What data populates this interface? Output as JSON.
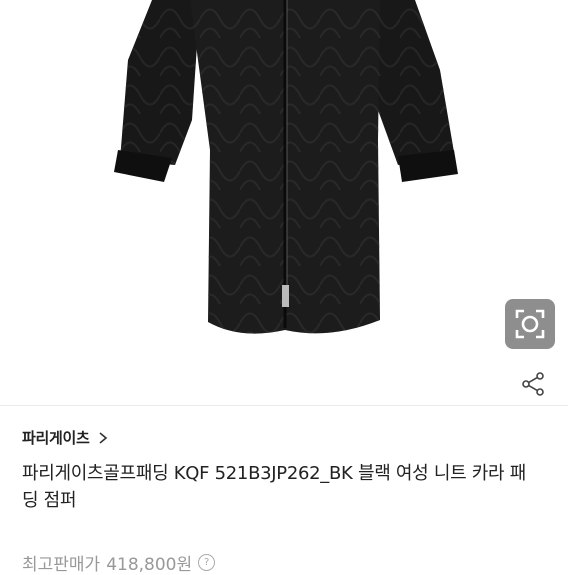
{
  "product": {
    "brand": "파리게이츠",
    "title": "파리게이츠골프패딩 KQF 521B3JP262_BK 블랙 여성 니트 카라 패딩 점퍼",
    "price_label": "최고판매가",
    "price_value": "418,800원",
    "info_symbol": "?"
  },
  "icons": {
    "image_search": "camera-lens-icon",
    "share": "share-icon",
    "brand_chevron": "chevron-right-icon"
  }
}
